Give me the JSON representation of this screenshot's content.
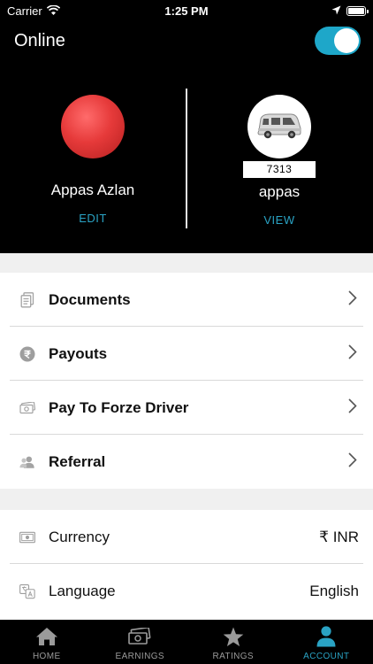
{
  "status_bar": {
    "carrier": "Carrier",
    "time": "1:25 PM"
  },
  "header": {
    "online_label": "Online",
    "toggle_on": true,
    "driver": {
      "name": "Appas Azlan",
      "action": "EDIT"
    },
    "vehicle": {
      "plate": "7313",
      "name": "appas",
      "action": "VIEW"
    }
  },
  "menu": {
    "items": [
      {
        "label": "Documents",
        "icon": "document-icon"
      },
      {
        "label": "Payouts",
        "icon": "payout-icon"
      },
      {
        "label": "Pay To Forze Driver",
        "icon": "cash-icon"
      },
      {
        "label": "Referral",
        "icon": "referral-icon"
      }
    ]
  },
  "settings": {
    "items": [
      {
        "label": "Currency",
        "value": "₹ INR",
        "icon": "currency-icon"
      },
      {
        "label": "Language",
        "value": "English",
        "icon": "language-icon"
      }
    ]
  },
  "tabbar": {
    "tabs": [
      {
        "label": "HOME",
        "icon": "home-icon"
      },
      {
        "label": "EARNINGS",
        "icon": "earnings-icon"
      },
      {
        "label": "RATINGS",
        "icon": "star-icon"
      },
      {
        "label": "ACCOUNT",
        "icon": "account-icon",
        "active": true
      }
    ]
  },
  "colors": {
    "accent": "#2aa3c4",
    "toggle": "#1ea7c9",
    "header_bg": "#000000"
  }
}
